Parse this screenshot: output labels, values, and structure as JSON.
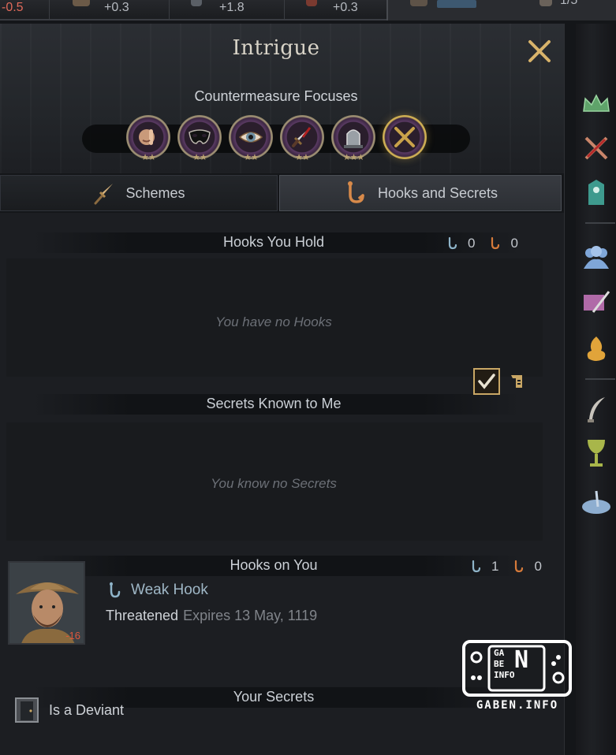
{
  "topbar": {
    "left_value": "-0.5",
    "res1": "+0.3",
    "res2": "+1.8",
    "res3": "+0.3",
    "right_value": "1/5"
  },
  "panel": {
    "title": "Intrigue",
    "countermeasure_label": "Countermeasure Focuses",
    "focuses": [
      {
        "icon": "hush-finger-icon",
        "stars": "★★"
      },
      {
        "icon": "mask-icon",
        "stars": "★★"
      },
      {
        "icon": "eye-icon",
        "stars": "★★"
      },
      {
        "icon": "bloody-dagger-icon",
        "stars": "★★"
      },
      {
        "icon": "tomb-icon",
        "stars": "★★★"
      },
      {
        "icon": "cross-icon",
        "stars": ""
      }
    ]
  },
  "tabs": {
    "schemes": "Schemes",
    "hooks_secrets": "Hooks and Secrets"
  },
  "hooks_you_hold": {
    "label": "Hooks You Hold",
    "weak_count": "0",
    "strong_count": "0",
    "empty": "You have no Hooks"
  },
  "secrets_known": {
    "label": "Secrets Known to Me",
    "empty": "You know no Secrets"
  },
  "hooks_on_you": {
    "label": "Hooks on You",
    "weak_count": "1",
    "strong_count": "0",
    "item": {
      "opinion": "-16",
      "hook_type": "Weak Hook",
      "status": "Threatened",
      "expires": "Expires 13 May, 1119"
    }
  },
  "your_secrets": {
    "label": "Your Secrets",
    "item": "Is a Deviant"
  },
  "watermark": {
    "caption": "GABEN.INFO",
    "l1": "GA",
    "l2": "BE",
    "l3": "INFO",
    "big": "N"
  },
  "colors": {
    "gold": "#c9a765",
    "weak_hook": "#8fb4c9",
    "strong_hook": "#d67a3a",
    "negative": "#e0573c"
  }
}
